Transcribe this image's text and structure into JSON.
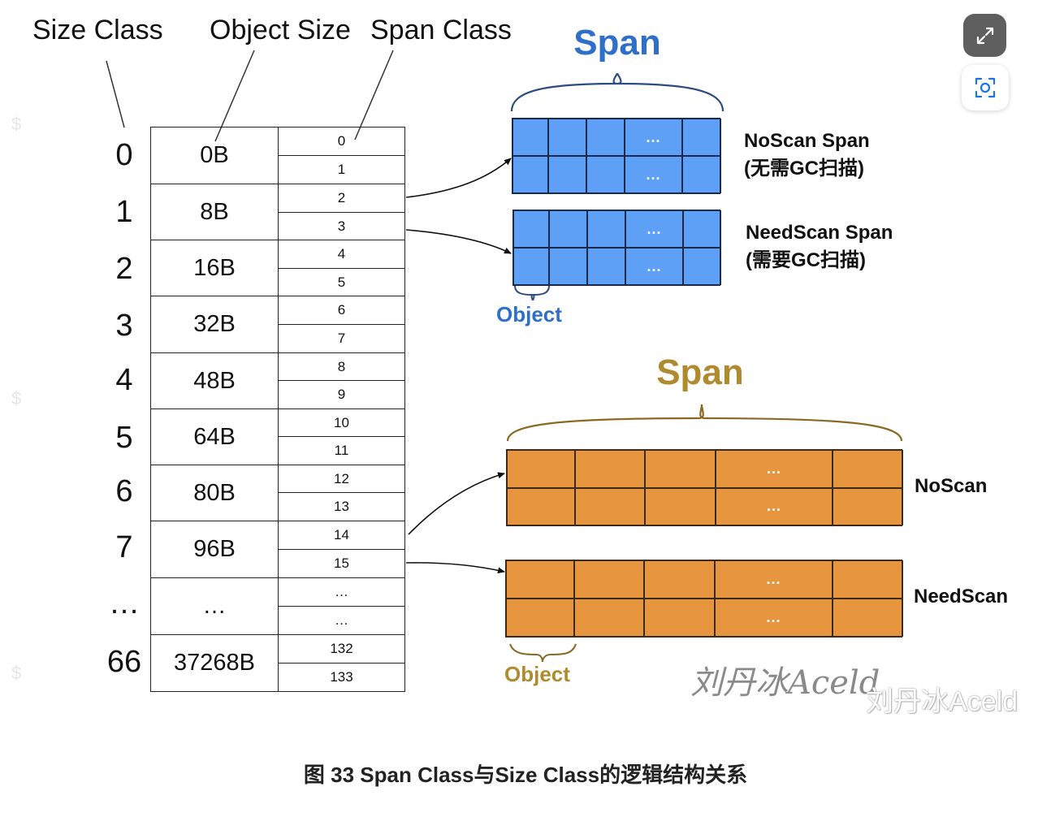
{
  "headers": {
    "size_class": "Size Class",
    "object_size": "Object Size",
    "span_class": "Span Class"
  },
  "size_classes": [
    "0",
    "1",
    "2",
    "3",
    "4",
    "5",
    "6",
    "7",
    "…",
    "66"
  ],
  "object_sizes": [
    "0B",
    "8B",
    "16B",
    "32B",
    "48B",
    "64B",
    "80B",
    "96B",
    "…",
    "37268B"
  ],
  "span_classes": [
    "0",
    "1",
    "2",
    "3",
    "4",
    "5",
    "6",
    "7",
    "8",
    "9",
    "10",
    "11",
    "12",
    "13",
    "14",
    "15",
    "…",
    "…",
    "132",
    "133"
  ],
  "blue_span": {
    "title": "Span",
    "color": "#2e6fc9",
    "fill": "#5da0f6",
    "ellipsis": "...",
    "noscan_label_1": "NoScan Span",
    "noscan_label_2": "(无需GC扫描)",
    "needscan_label_1": "NeedScan Span",
    "needscan_label_2": "(需要GC扫描)",
    "object_label": "Object"
  },
  "orange_span": {
    "title": "Span",
    "color": "#b08a2e",
    "fill": "#e8953f",
    "ellipsis": "...",
    "noscan_label": "NoScan",
    "needscan_label": "NeedScan",
    "object_label": "Object"
  },
  "watermark": {
    "handwritten": "刘丹冰Aceld",
    "text": "刘丹冰Aceld"
  },
  "caption": "图 33 Span Class与Size Class的逻辑结构关系",
  "icons": {
    "expand": "expand-icon",
    "scan": "scan-icon"
  }
}
